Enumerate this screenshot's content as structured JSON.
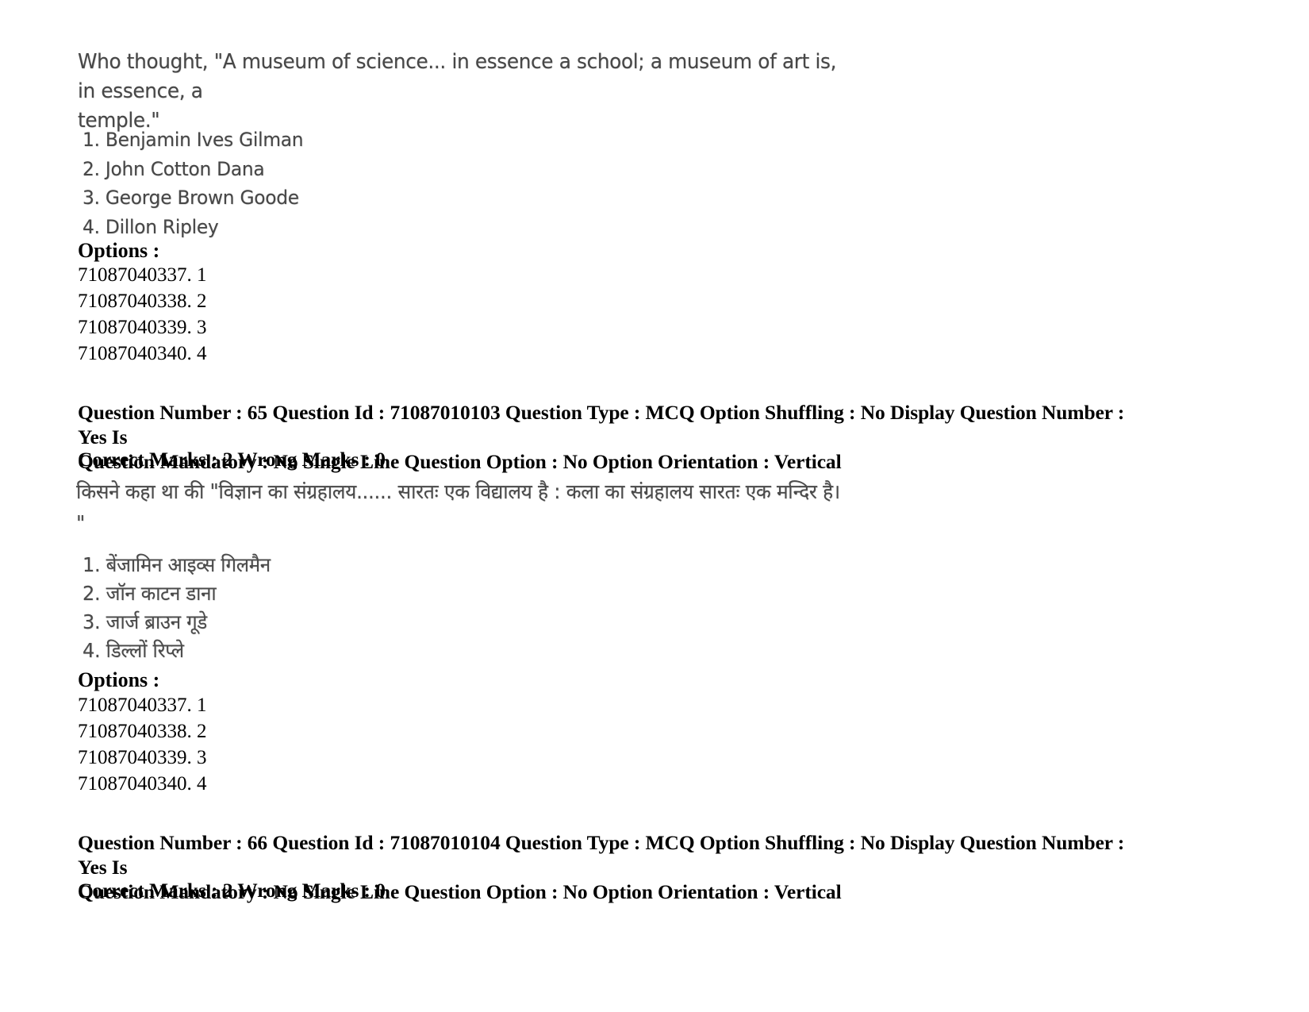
{
  "document": {
    "type": "exam-question-paper",
    "background_color": "#ffffff",
    "text_color": "#000000",
    "scanned_text_color": "#3a3a3a"
  },
  "questions": [
    {
      "id": "q64",
      "language": "English",
      "stem_line_1": "Who thought, \"A museum of science... in essence a school; a museum of art is, in essence, a",
      "stem_line_2": "temple.\"",
      "choices": [
        "1. Benjamin Ives Gilman",
        "2. John Cotton Dana",
        "3. George Brown Goode",
        "4. Dillon Ripley"
      ],
      "options_label": "Options :",
      "option_ids": [
        "71087040337. 1",
        "71087040338. 2",
        "71087040339. 3",
        "71087040340. 4"
      ]
    },
    {
      "id": "q65",
      "language": "Hindi",
      "meta_line_1": "Question Number : 65 Question Id : 71087010103 Question Type : MCQ Option Shuffling : No Display Question Number : Yes Is",
      "meta_line_2": "Question Mandatory : No Single Line Question Option : No Option Orientation : Vertical",
      "marks_line": "Correct Marks : 2 Wrong Marks : 0",
      "stem_line_1": "किसने कहा था की \"विज्ञान का संग्रहालय...... सारतः एक विद्यालय है : कला का संग्रहालय सारतः एक मन्दिर है।",
      "stem_line_2": "\"",
      "choices": [
        "1. बेंजामिन आइव्स गिलमैन",
        "2. जॉन काटन डाना",
        "3. जार्ज ब्राउन गूडे",
        "4. डिल्लों रिप्ले"
      ],
      "options_label": "Options :",
      "option_ids": [
        "71087040337. 1",
        "71087040338. 2",
        "71087040339. 3",
        "71087040340. 4"
      ]
    },
    {
      "id": "q66",
      "language": "English",
      "meta_line_1": "Question Number : 66 Question Id : 71087010104 Question Type : MCQ Option Shuffling : No Display Question Number : Yes Is",
      "meta_line_2": "Question Mandatory : No Single Line Question Option : No Option Orientation : Vertical",
      "marks_line": "Correct Marks : 2 Wrong Marks : 0"
    }
  ]
}
